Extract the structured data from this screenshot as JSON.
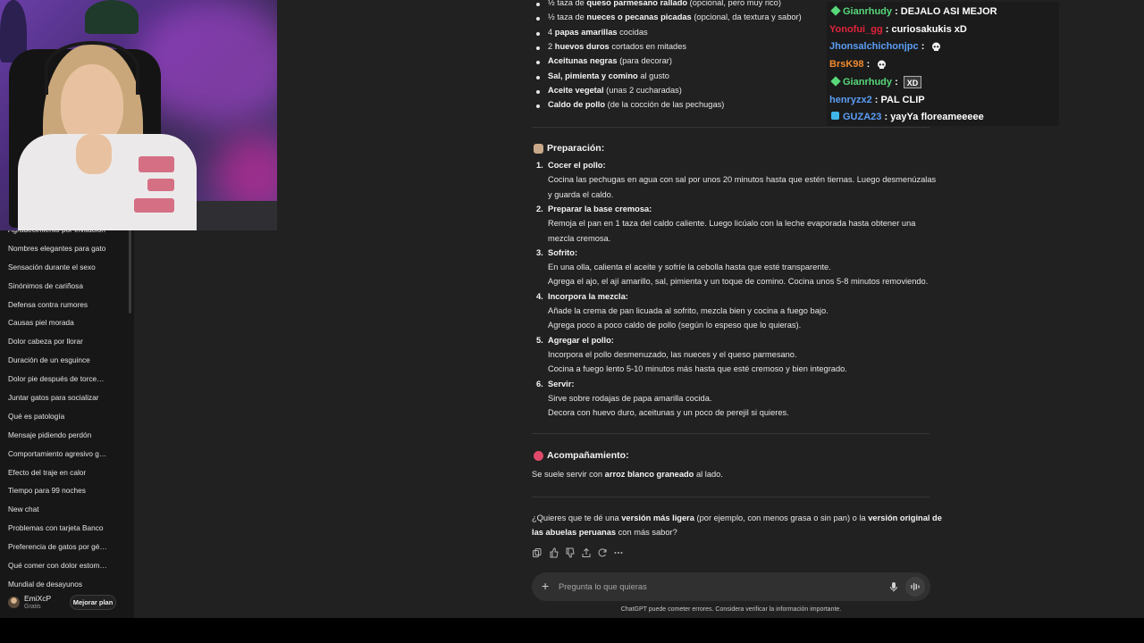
{
  "colors": {
    "background": "#212121",
    "sidebar": "#171717",
    "composer": "#303030",
    "chat_green": "#57d87a",
    "chat_red": "#e0243a",
    "chat_blue": "#5b9df5",
    "chat_orange": "#f08a2e"
  },
  "sidebar": {
    "items": [
      "Agradecimiento por invitación",
      "Nombres elegantes para gato",
      "Sensación durante el sexo",
      "Sinónimos de cariñosa",
      "Defensa contra rumores",
      "Causas piel morada",
      "Dolor cabeza por llorar",
      "Duración de un esguince",
      "Dolor pie después de torcedura",
      "Juntar gatos para socializar",
      "Qué es patología",
      "Mensaje pidiendo perdón",
      "Comportamiento agresivo gato",
      "Efecto del traje en calor",
      "Tiempo para 99 noches",
      "New chat",
      "Problemas con tarjeta Banco",
      "Preferencia de gatos por género",
      "Qué comer con dolor estomacal",
      "Mundial de desayunos"
    ],
    "user": {
      "name": "EmiXcP",
      "plan": "Gratis",
      "upgrade_label": "Mejorar plan"
    }
  },
  "chat": {
    "lines": [
      {
        "user": "Gianrhudy",
        "color": "#57d87a",
        "badge": "diamond",
        "msg": "DEJALO ASI MEJOR"
      },
      {
        "user": "Yonofui_gg",
        "color": "#e0243a",
        "badge": "",
        "msg": "curiosakukis xD"
      },
      {
        "user": "Jhonsalchichonjpc",
        "color": "#5b9df5",
        "badge": "",
        "msg": "",
        "emote": "skull"
      },
      {
        "user": "BrsK98",
        "color": "#f08a2e",
        "badge": "",
        "msg": "",
        "emote": "skull"
      },
      {
        "user": "Gianrhudy",
        "color": "#57d87a",
        "badge": "diamond",
        "msg": "",
        "box": "XD"
      },
      {
        "user": "henryzx2",
        "color": "#5b9df5",
        "badge": "",
        "msg": "PAL CLIP"
      },
      {
        "user": "GUZA23",
        "color": "#5b9df5",
        "badge": "cube",
        "msg": "yayYa floreameeeee"
      }
    ]
  },
  "ingredients": [
    {
      "pre": "½ taza de ",
      "bold": "queso parmesano rallado",
      "post": " (opcional, pero muy rico)"
    },
    {
      "pre": "½ taza de ",
      "bold": "nueces o pecanas picadas",
      "post": " (opcional, da textura y sabor)"
    },
    {
      "pre": "4 ",
      "bold": "papas amarillas",
      "post": " cocidas"
    },
    {
      "pre": "2 ",
      "bold": "huevos duros",
      "post": " cortados en mitades"
    },
    {
      "pre": "",
      "bold": "Aceitunas negras",
      "post": " (para decorar)"
    },
    {
      "pre": "",
      "bold": "Sal, pimienta y comino",
      "post": " al gusto"
    },
    {
      "pre": "",
      "bold": "Aceite vegetal",
      "post": " (unas 2 cucharadas)"
    },
    {
      "pre": "",
      "bold": "Caldo de pollo",
      "post": " (de la cocción de las pechugas)"
    }
  ],
  "preparation": {
    "title": "Preparación:",
    "steps": [
      {
        "num": "1.",
        "title": "Cocer el pollo:",
        "lines": [
          "Cocina las pechugas en agua con sal por unos 20 minutos hasta que estén tiernas. Luego desmenúzalas",
          "y guarda el caldo."
        ]
      },
      {
        "num": "2.",
        "title": "Preparar la base cremosa:",
        "lines": [
          "Remoja el pan en 1 taza del caldo caliente. Luego licúalo con la leche evaporada hasta obtener una",
          "mezcla cremosa."
        ]
      },
      {
        "num": "3.",
        "title": "Sofrito:",
        "lines": [
          "En una olla, calienta el aceite y sofríe la cebolla hasta que esté transparente.",
          "Agrega el ajo, el ají amarillo, sal, pimienta y un toque de comino. Cocina unos 5-8 minutos removiendo."
        ]
      },
      {
        "num": "4.",
        "title": "Incorpora la mezcla:",
        "lines": [
          "Añade la crema de pan licuada al sofrito, mezcla bien y cocina a fuego bajo.",
          "Agrega poco a poco caldo de pollo (según lo espeso que lo quieras)."
        ]
      },
      {
        "num": "5.",
        "title": "Agregar el pollo:",
        "lines": [
          "Incorpora el pollo desmenuzado, las nueces y el queso parmesano.",
          "Cocina a fuego lento 5-10 minutos más hasta que esté cremoso y bien integrado."
        ]
      },
      {
        "num": "6.",
        "title": "Servir:",
        "lines": [
          "Sirve sobre rodajas de papa amarilla cocida.",
          "Decora con huevo duro, aceitunas y un poco de perejil si quieres."
        ]
      }
    ]
  },
  "accompaniment": {
    "title": "Acompañamiento:",
    "pre": "Se suele servir con ",
    "bold": "arroz blanco graneado",
    "post": " al lado."
  },
  "question": {
    "p1": "¿Quieres que te dé una ",
    "b1": "versión más ligera",
    "p2": " (por ejemplo, con menos grasa o sin pan) o la ",
    "b2": "versión original de",
    "b3": "las abuelas peruanas",
    "p3": " con más sabor?"
  },
  "actions": [
    "copy-icon",
    "thumbs-up-icon",
    "thumbs-down-icon",
    "share-icon",
    "regenerate-icon",
    "more-icon"
  ],
  "composer": {
    "placeholder": "Pregunta lo que quieras"
  },
  "disclaimer": "ChatGPT puede cometer errores. Considera verificar la información importante."
}
